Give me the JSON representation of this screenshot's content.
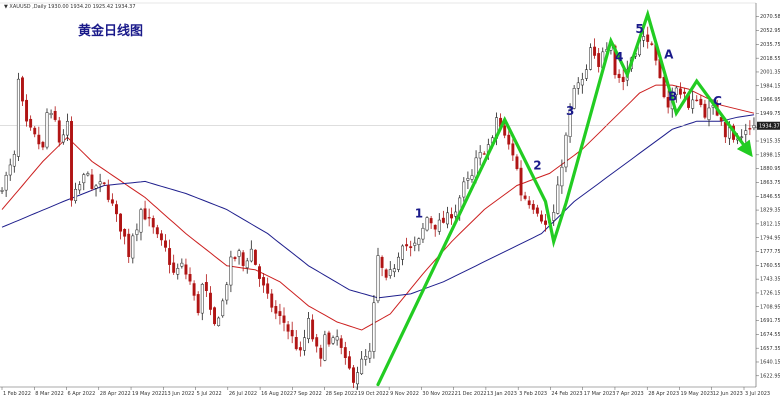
{
  "window": {
    "header_text": "▼ XAUUSD ,Daily 1930.00 1934.20 1925.42 1934.37"
  },
  "chart_data": {
    "type": "candlestick",
    "title": "黄金日线图",
    "instrument": "XAUUSD",
    "timeframe": "Daily",
    "ohlc_header": "1930.00 1934.20 1925.42 1934.37",
    "current_price": "1934.37",
    "ylim": [
      1609,
      2086
    ],
    "x_ticks": [
      "1 Feb 2022",
      "8 Mar 2022",
      "6 Apr 2022",
      "28 Apr 2022",
      "19 May 2022",
      "13 Jun 2022",
      "5 Jul 2022",
      "26 Jul 2022",
      "16 Aug 2022",
      "7 Sep 2022",
      "28 Sep 2022",
      "19 Oct 2022",
      "9 Nov 2022",
      "30 Nov 2022",
      "21 Dec 2022",
      "13 Jan 2023",
      "3 Feb 2023",
      "24 Feb 2023",
      "17 Mar 2023",
      "7 Apr 2023",
      "28 Apr 2023",
      "19 May 2023",
      "12 Jun 2023",
      "3 Jul 2023"
    ],
    "y_ticks": [
      "2070.58",
      "2052.95",
      "2035.75",
      "2018.55",
      "2001.35",
      "1984.15",
      "1966.95",
      "1949.75",
      "1932.55",
      "1915.35",
      "1898.15",
      "1880.95",
      "1863.75",
      "1846.55",
      "1829.35",
      "1812.15",
      "1794.95",
      "1777.75",
      "1760.55",
      "1743.35",
      "1726.15",
      "1708.95",
      "1691.75",
      "1674.55",
      "1657.35",
      "1640.15",
      "1622.95"
    ],
    "price_path": [
      [
        0,
        1850
      ],
      [
        2,
        1870
      ],
      [
        4,
        1895
      ],
      [
        5,
        1990
      ],
      [
        6,
        1960
      ],
      [
        7,
        1935
      ],
      [
        9,
        1920
      ],
      [
        11,
        1905
      ],
      [
        12,
        1950
      ],
      [
        14,
        1940
      ],
      [
        15,
        1915
      ],
      [
        17,
        1935
      ],
      [
        18,
        1840
      ],
      [
        20,
        1860
      ],
      [
        22,
        1880
      ],
      [
        23,
        1850
      ],
      [
        24,
        1860
      ],
      [
        26,
        1860
      ],
      [
        28,
        1835
      ],
      [
        29,
        1820
      ],
      [
        31,
        1795
      ],
      [
        32,
        1775
      ],
      [
        33,
        1800
      ],
      [
        34,
        1810
      ],
      [
        35,
        1830
      ],
      [
        37,
        1815
      ],
      [
        39,
        1795
      ],
      [
        41,
        1780
      ],
      [
        43,
        1750
      ],
      [
        45,
        1760
      ],
      [
        47,
        1740
      ],
      [
        48,
        1720
      ],
      [
        49,
        1705
      ],
      [
        50,
        1735
      ],
      [
        51,
        1725
      ],
      [
        52,
        1700
      ],
      [
        53,
        1685
      ],
      [
        55,
        1715
      ],
      [
        57,
        1765
      ],
      [
        59,
        1775
      ],
      [
        60,
        1760
      ],
      [
        62,
        1780
      ],
      [
        64,
        1745
      ],
      [
        66,
        1720
      ],
      [
        68,
        1700
      ],
      [
        70,
        1690
      ],
      [
        72,
        1670
      ],
      [
        74,
        1650
      ],
      [
        76,
        1690
      ],
      [
        77,
        1670
      ],
      [
        78,
        1655
      ],
      [
        79,
        1640
      ],
      [
        80,
        1680
      ],
      [
        81,
        1660
      ],
      [
        83,
        1670
      ],
      [
        85,
        1640
      ],
      [
        87,
        1620
      ],
      [
        88,
        1630
      ],
      [
        89,
        1640
      ],
      [
        91,
        1650
      ],
      [
        92,
        1710
      ],
      [
        93,
        1770
      ],
      [
        95,
        1740
      ],
      [
        97,
        1760
      ],
      [
        99,
        1790
      ],
      [
        101,
        1780
      ],
      [
        103,
        1790
      ],
      [
        105,
        1820
      ],
      [
        107,
        1810
      ],
      [
        109,
        1815
      ],
      [
        112,
        1830
      ],
      [
        114,
        1860
      ],
      [
        116,
        1870
      ],
      [
        117,
        1890
      ],
      [
        119,
        1905
      ],
      [
        121,
        1915
      ],
      [
        122,
        1945
      ],
      [
        124,
        1920
      ],
      [
        126,
        1900
      ],
      [
        127,
        1880
      ],
      [
        128,
        1850
      ],
      [
        130,
        1840
      ],
      [
        132,
        1830
      ],
      [
        134,
        1810
      ],
      [
        135,
        1815
      ],
      [
        136,
        1825
      ],
      [
        137,
        1855
      ],
      [
        139,
        1920
      ],
      [
        141,
        1980
      ],
      [
        143,
        1990
      ],
      [
        144,
        2000
      ],
      [
        145,
        2030
      ],
      [
        147,
        2005
      ],
      [
        148,
        2030
      ],
      [
        150,
        2040
      ],
      [
        151,
        2000
      ],
      [
        153,
        1990
      ],
      [
        155,
        2020
      ],
      [
        157,
        2040
      ],
      [
        159,
        2045
      ],
      [
        160,
        2030
      ],
      [
        162,
        1990
      ],
      [
        164,
        1960
      ],
      [
        166,
        1980
      ],
      [
        168,
        1975
      ],
      [
        169,
        1955
      ],
      [
        171,
        1970
      ],
      [
        173,
        1950
      ],
      [
        175,
        1955
      ],
      [
        177,
        1945
      ],
      [
        178,
        1925
      ],
      [
        179,
        1935
      ],
      [
        180,
        1915
      ],
      [
        182,
        1920
      ],
      [
        183,
        1930
      ],
      [
        184,
        1934
      ]
    ],
    "series": [
      {
        "name": "MA (red)",
        "color": "#cc1f1f",
        "values": [
          [
            0,
            1830
          ],
          [
            10,
            1890
          ],
          [
            16,
            1920
          ],
          [
            22,
            1890
          ],
          [
            35,
            1845
          ],
          [
            45,
            1800
          ],
          [
            55,
            1760
          ],
          [
            62,
            1755
          ],
          [
            68,
            1740
          ],
          [
            75,
            1710
          ],
          [
            82,
            1690
          ],
          [
            88,
            1680
          ],
          [
            95,
            1700
          ],
          [
            103,
            1750
          ],
          [
            110,
            1790
          ],
          [
            118,
            1830
          ],
          [
            126,
            1860
          ],
          [
            134,
            1875
          ],
          [
            142,
            1905
          ],
          [
            150,
            1945
          ],
          [
            156,
            1975
          ],
          [
            160,
            1985
          ],
          [
            164,
            1985
          ],
          [
            168,
            1980
          ],
          [
            172,
            1970
          ],
          [
            176,
            1960
          ],
          [
            180,
            1955
          ],
          [
            184,
            1950
          ]
        ]
      },
      {
        "name": "MA (blue)",
        "color": "#1e1e8c",
        "values": [
          [
            0,
            1808
          ],
          [
            15,
            1840
          ],
          [
            25,
            1860
          ],
          [
            35,
            1865
          ],
          [
            45,
            1850
          ],
          [
            55,
            1830
          ],
          [
            65,
            1800
          ],
          [
            75,
            1760
          ],
          [
            85,
            1730
          ],
          [
            92,
            1720
          ],
          [
            100,
            1725
          ],
          [
            108,
            1740
          ],
          [
            116,
            1760
          ],
          [
            124,
            1780
          ],
          [
            132,
            1800
          ],
          [
            140,
            1840
          ],
          [
            148,
            1870
          ],
          [
            156,
            1900
          ],
          [
            164,
            1930
          ],
          [
            170,
            1940
          ],
          [
            176,
            1940
          ],
          [
            180,
            1945
          ],
          [
            184,
            1948
          ]
        ]
      }
    ],
    "wave_path": [
      [
        92,
        1612
      ],
      [
        123,
        1942
      ],
      [
        133,
        1840
      ],
      [
        135,
        1790
      ],
      [
        138,
        1838
      ],
      [
        149,
        2040
      ],
      [
        153,
        1998
      ],
      [
        158,
        2073
      ],
      [
        165,
        1950
      ],
      [
        170,
        1990
      ],
      [
        183,
        1900
      ]
    ],
    "annotations": [
      {
        "text": "1",
        "x": 101,
        "y": 1820
      },
      {
        "text": "2",
        "x": 130,
        "y": 1880
      },
      {
        "text": "3",
        "x": 138,
        "y": 1948
      },
      {
        "text": "4",
        "x": 150,
        "y": 2015
      },
      {
        "text": "5",
        "x": 155,
        "y": 2050
      },
      {
        "text": "A",
        "x": 162,
        "y": 2018
      },
      {
        "text": "B",
        "x": 163,
        "y": 1966
      },
      {
        "text": "C",
        "x": 174,
        "y": 1960
      }
    ],
    "colors": {
      "bull": "#1f1f1f",
      "bear": "#b01414",
      "wave": "#22cc22",
      "current_price_bg": "#1f1f1f",
      "label": "#1a1a8a"
    },
    "grid": false
  }
}
